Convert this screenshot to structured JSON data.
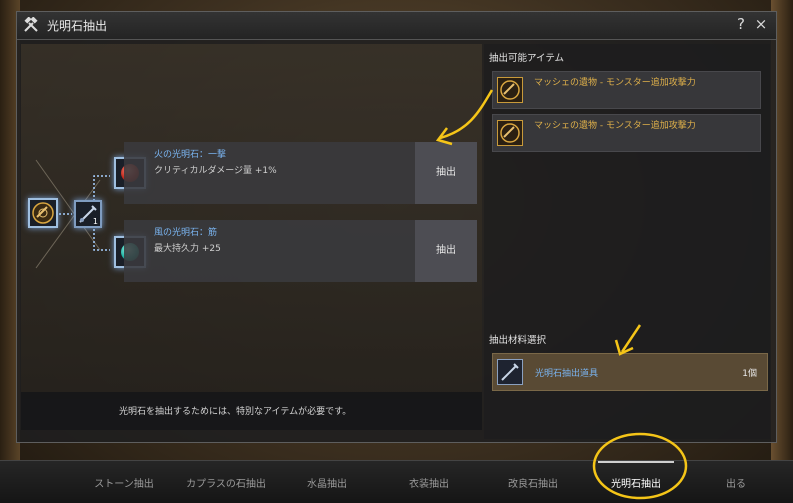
{
  "window": {
    "title": "光明石抽出",
    "help_label": "?",
    "close_label": "×"
  },
  "left_panel": {
    "stones": [
      {
        "name": "火の光明石：一撃",
        "effect": "クリティカルダメージ量 +1%",
        "button_label": "抽出",
        "gem_color": "#c0281c"
      },
      {
        "name": "風の光明石：筋",
        "effect": "最大持久力 +25",
        "button_label": "抽出",
        "gem_color": "#1fb3a3"
      }
    ],
    "tool_slot_count": "1",
    "message": "光明石を抽出するためには、特別なアイテムが必要です。"
  },
  "right_panel": {
    "extractable_title": "抽出可能アイテム",
    "items": [
      {
        "name": "マッシェの遺物 - モンスター追加攻撃力",
        "icon": "machete-relic-icon"
      },
      {
        "name": "マッシェの遺物 - モンスター追加攻撃力",
        "icon": "machete-relic-icon"
      }
    ],
    "material_title": "抽出材料選択",
    "material": {
      "name": "光明石抽出道具",
      "quantity": "1個",
      "icon": "extraction-tool-icon"
    }
  },
  "tabs": [
    {
      "label": "ストーン抽出",
      "active": false
    },
    {
      "label": "カプラスの石抽出",
      "active": false
    },
    {
      "label": "水晶抽出",
      "active": false
    },
    {
      "label": "衣装抽出",
      "active": false
    },
    {
      "label": "改良石抽出",
      "active": false
    },
    {
      "label": "光明石抽出",
      "active": true
    },
    {
      "label": "出る",
      "active": false
    }
  ],
  "colors": {
    "accent_blue": "#7ab4f0",
    "item_gold": "#e0b14a",
    "annotation_yellow": "#f5c518"
  }
}
